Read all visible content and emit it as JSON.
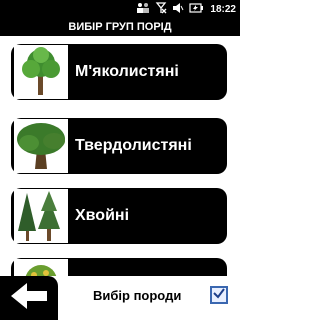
{
  "status": {
    "time": "18:22",
    "icons": [
      "multi-user-icon",
      "no-signal-icon",
      "speaker-icon",
      "battery-charging-icon"
    ]
  },
  "title": "ВИБІР ГРУП ПОРІД",
  "groups": [
    {
      "label": "М'яколистяні",
      "icon": "deciduous-tree-icon"
    },
    {
      "label": "Твердолистяні",
      "icon": "oak-tree-icon"
    },
    {
      "label": "Хвойні",
      "icon": "conifer-tree-icon"
    },
    {
      "label": "",
      "icon": "fruit-tree-icon"
    }
  ],
  "footer": {
    "back_icon": "back-arrow-icon",
    "select_label": "Вибір породи",
    "select_checked": true
  },
  "colors": {
    "button_bg": "#000000",
    "text_on_button": "#ffffff",
    "checkbox_accent": "#3a67b0"
  }
}
